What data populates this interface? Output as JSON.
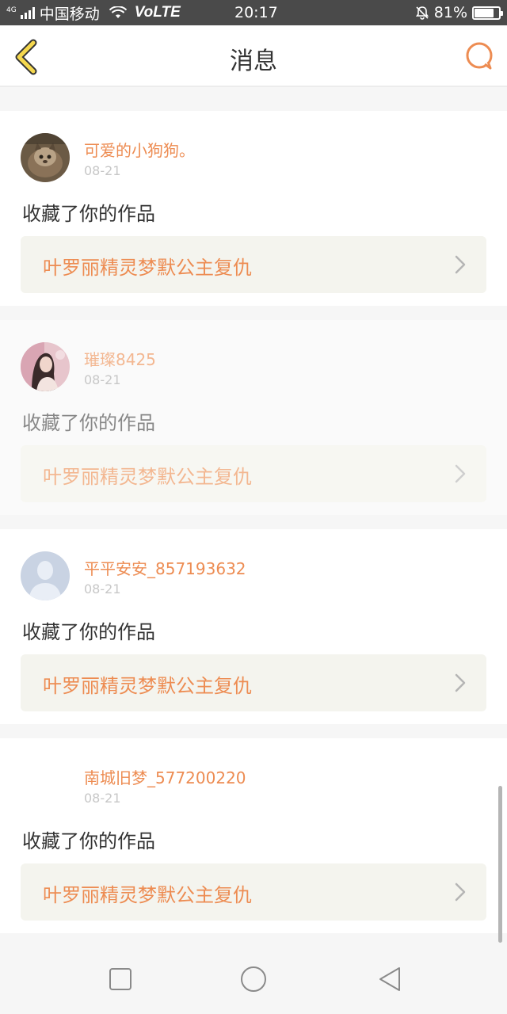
{
  "status_bar": {
    "network_type": "4G",
    "carrier": "中国移动",
    "volte": "VoLTE",
    "time": "20:17",
    "battery_percent": "81%",
    "battery_level": 0.81,
    "icons": [
      "signal-icon",
      "wifi-icon",
      "alarm-off-icon",
      "battery-icon"
    ]
  },
  "header": {
    "title": "消息",
    "back_icon": "chevron-left-icon",
    "chat_icon": "chat-bubble-icon"
  },
  "colors": {
    "accent": "#ed8c52",
    "back_icon": "#f5d84e",
    "card_bg": "#f4f4ee",
    "date": "#c7c7c7"
  },
  "messages": [
    {
      "username": "可爱的小狗狗。",
      "date": "08-21",
      "action": "收藏了你的作品",
      "work_title": "叶罗丽精灵梦默公主复仇",
      "avatar": "cat-photo-avatar"
    },
    {
      "username": "璀璨8425",
      "date": "08-21",
      "action": "收藏了你的作品",
      "work_title": "叶罗丽精灵梦默公主复仇",
      "avatar": "girl-photo-avatar"
    },
    {
      "username": "平平安安_857193632",
      "date": "08-21",
      "action": "收藏了你的作品",
      "work_title": "叶罗丽精灵梦默公主复仇",
      "avatar": "default-user-avatar"
    },
    {
      "username": "南城旧梦_577200220",
      "date": "08-21",
      "action": "收藏了你的作品",
      "work_title": "叶罗丽精灵梦默公主复仇",
      "avatar": "blank-avatar"
    }
  ],
  "nav_bar": {
    "icons": [
      "recent-apps-icon",
      "home-icon",
      "back-triangle-icon"
    ]
  }
}
